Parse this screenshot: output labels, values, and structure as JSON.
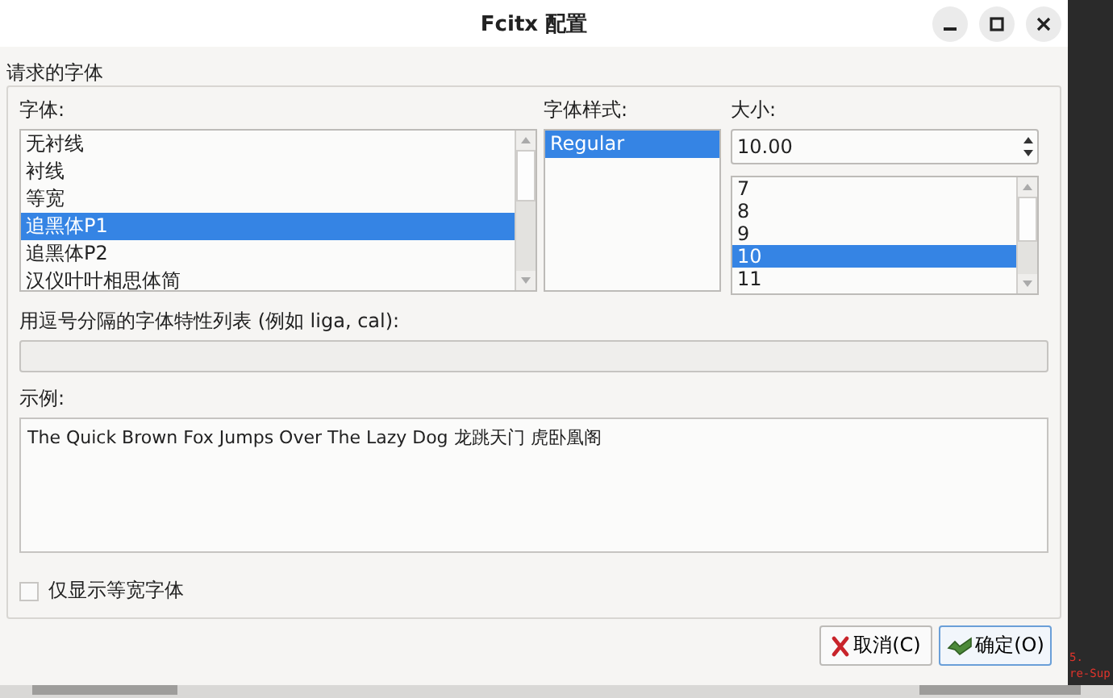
{
  "window": {
    "title": "Fcitx 配置"
  },
  "group": {
    "title": "请求的字体"
  },
  "family": {
    "label": "字体:",
    "items": [
      {
        "text": "无衬线",
        "selected": false
      },
      {
        "text": "衬线",
        "selected": false
      },
      {
        "text": "等宽",
        "selected": false
      },
      {
        "text": "追黑体P1",
        "selected": true
      },
      {
        "text": "追黑体P2",
        "selected": false
      },
      {
        "text": "汉仪叶叶相思体简",
        "selected": false
      }
    ]
  },
  "style": {
    "label": "字体样式:",
    "items": [
      {
        "text": "Regular",
        "selected": true
      }
    ]
  },
  "size": {
    "label": "大小:",
    "value": "10.00",
    "items": [
      {
        "text": "7",
        "selected": false
      },
      {
        "text": "8",
        "selected": false
      },
      {
        "text": "9",
        "selected": false
      },
      {
        "text": "10",
        "selected": true
      },
      {
        "text": "11",
        "selected": false
      }
    ]
  },
  "features": {
    "label": "用逗号分隔的字体特性列表 (例如 liga, cal):"
  },
  "sample": {
    "label": "示例:",
    "text": "The Quick Brown Fox Jumps Over The Lazy Dog 龙跳天门 虎卧凰阁"
  },
  "monospace_only": {
    "label": "仅显示等宽字体",
    "checked": false
  },
  "buttons": [
    {
      "kind": "cancel",
      "label": "取消(C)"
    },
    {
      "kind": "ok",
      "label": "确定(O)"
    }
  ],
  "background_terminal": [
    "5.",
    "re-Sup"
  ]
}
